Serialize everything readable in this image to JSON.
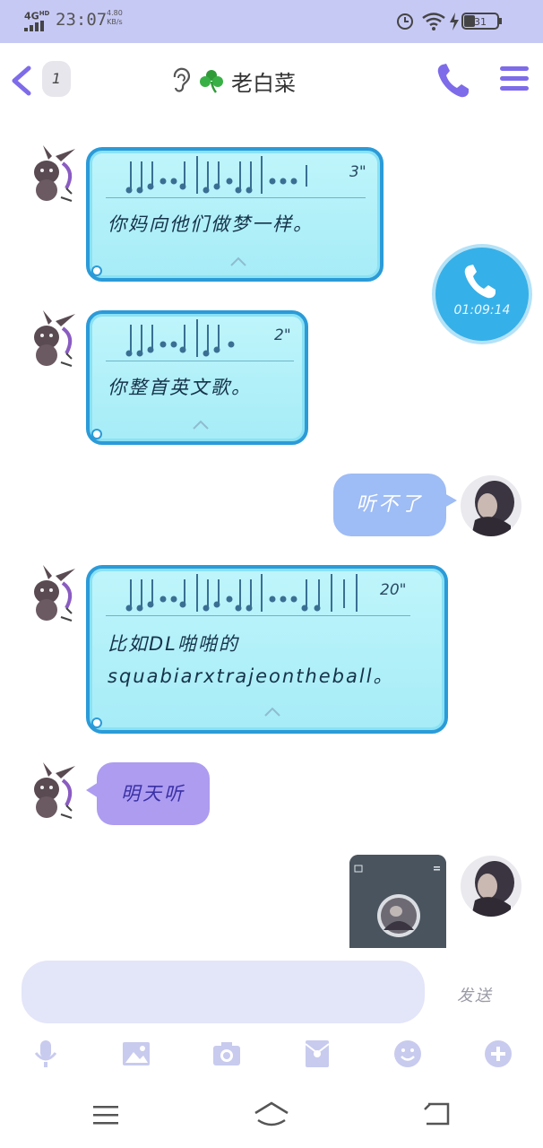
{
  "status_bar": {
    "network": "4G",
    "network_sup": "HD",
    "time": "23:07",
    "speed_value": "4.80",
    "speed_unit": "KB/s",
    "battery": "31"
  },
  "header": {
    "unread_count": "1",
    "contact_name": "老白菜"
  },
  "messages": [
    {
      "type": "voice",
      "side": "left",
      "duration": "3\"",
      "transcript": "你妈向他们做梦一样。"
    },
    {
      "type": "call",
      "side": "right",
      "call_time": "01:09:14"
    },
    {
      "type": "voice",
      "side": "left",
      "duration": "2\"",
      "transcript": "你整首英文歌。"
    },
    {
      "type": "text",
      "side": "right",
      "text": "听不了"
    },
    {
      "type": "voice",
      "side": "left",
      "duration": "20\"",
      "transcript_line1": "比如DL啪啪的",
      "transcript_line2": "squabiarxtrajeontheball。"
    },
    {
      "type": "text",
      "side": "left",
      "text": "明天听"
    },
    {
      "type": "image",
      "side": "right"
    }
  ],
  "composer": {
    "input_value": "",
    "send_label": "发送"
  },
  "toolbar_icons": [
    "microphone-icon",
    "image-icon",
    "camera-icon",
    "red-packet-icon",
    "emoji-icon",
    "plus-icon"
  ],
  "colors": {
    "status_bar_bg": "#c7c9f5",
    "accent": "#7e6bea",
    "voice_bubble": "#a6ecf7",
    "voice_border": "#2b9bd8",
    "sent_bubble": "#9ebcf5",
    "recv_purple": "#ad9cf0"
  }
}
